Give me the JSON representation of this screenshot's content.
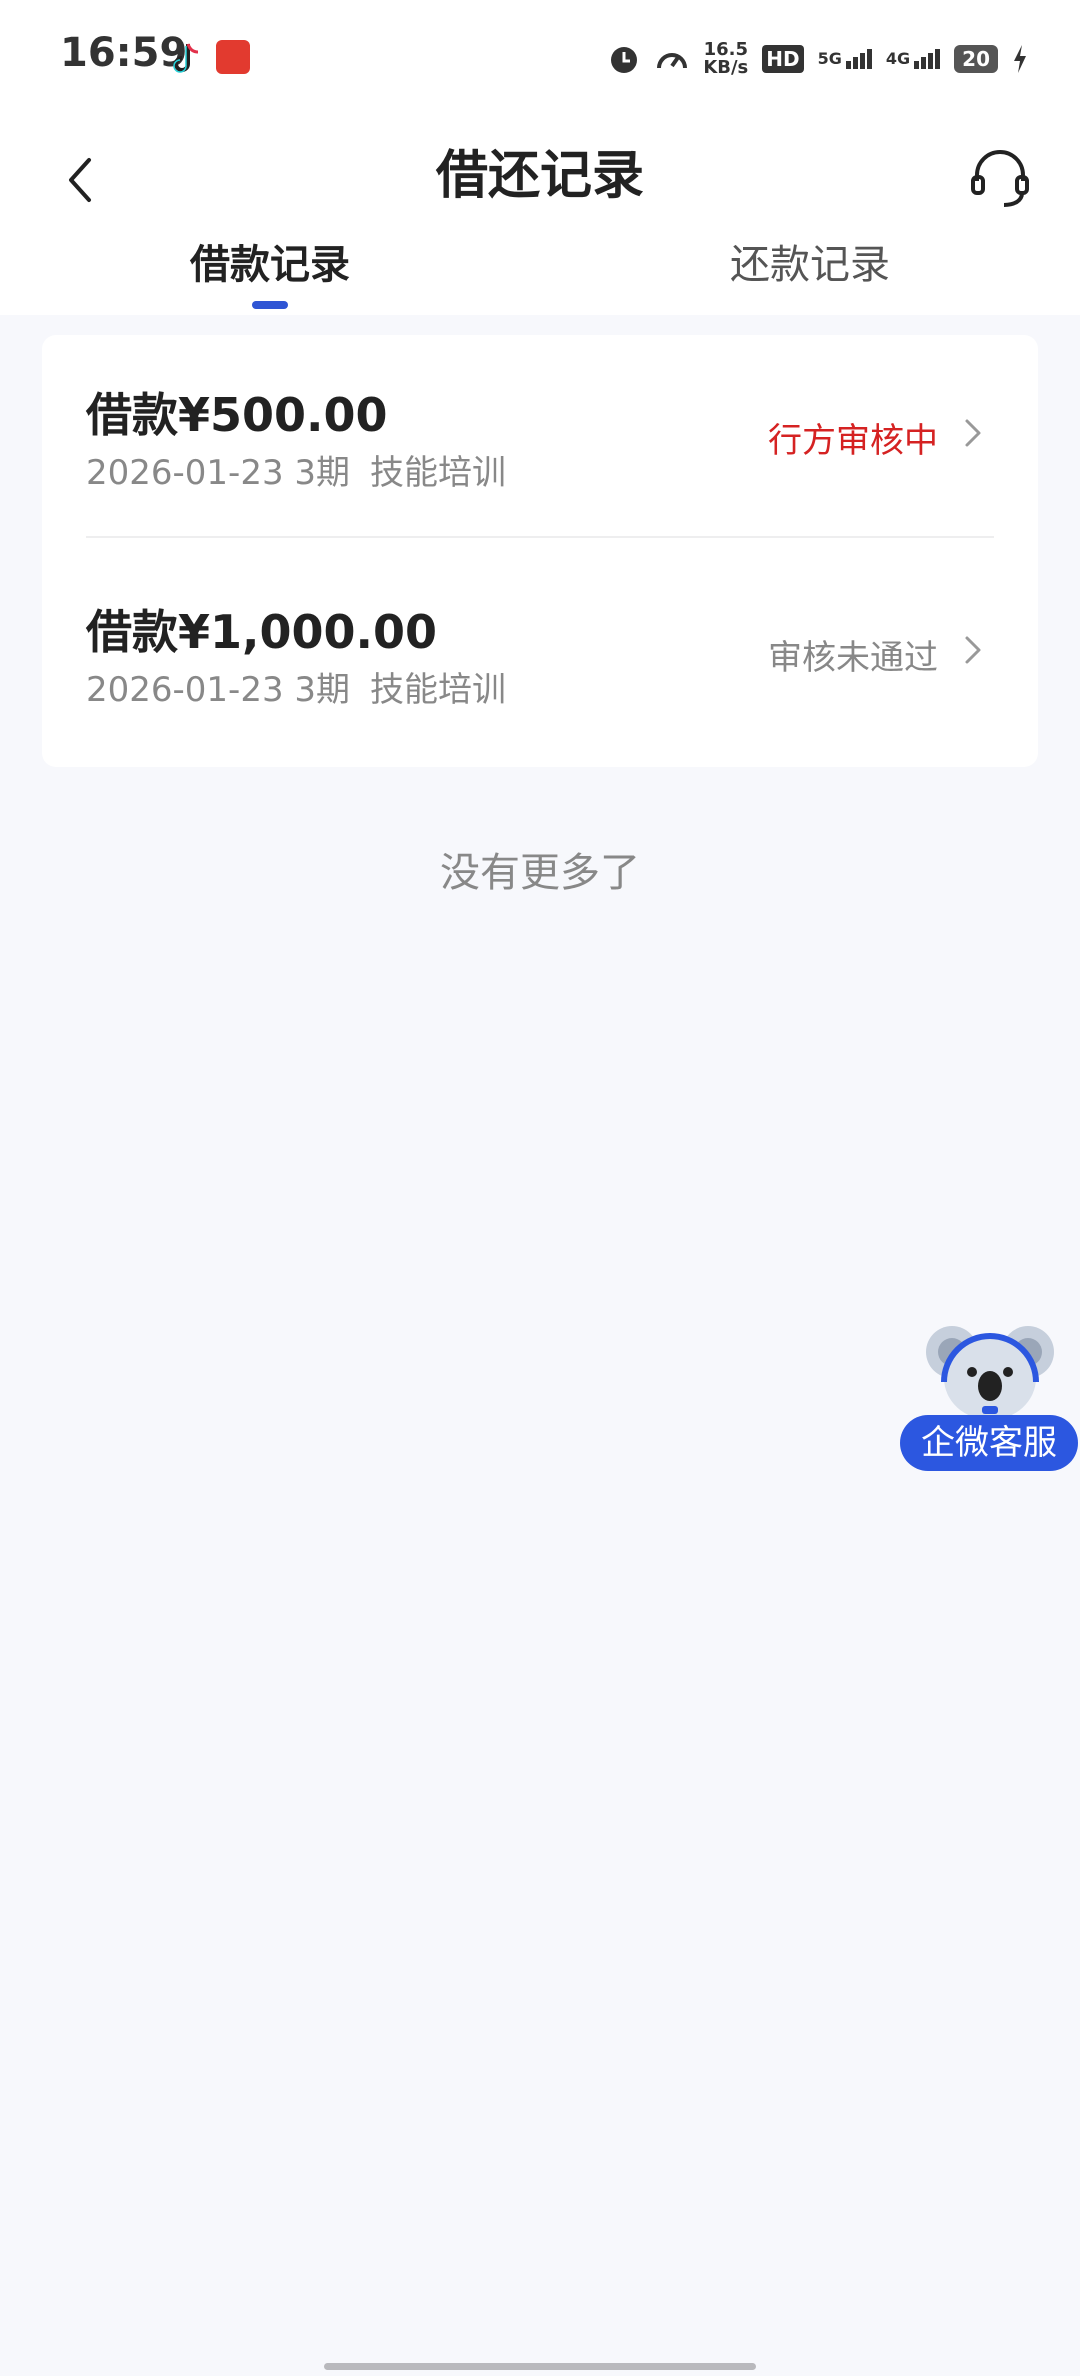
{
  "status_bar": {
    "time": "16:59",
    "net_speed_value": "16.5",
    "net_speed_unit": "KB/s",
    "hd_label": "HD",
    "sim1_label": "5G",
    "sim2_label": "4G",
    "battery": "20"
  },
  "header": {
    "title": "借还记录",
    "back_icon": "chevron-left-icon",
    "service_icon": "headset-icon"
  },
  "tabs": [
    {
      "label": "借款记录",
      "active": true
    },
    {
      "label": "还款记录",
      "active": false
    }
  ],
  "records": [
    {
      "amount": "借款¥500.00",
      "date": "2026-01-23",
      "term": "3期",
      "purpose": "技能培训",
      "status": "行方审核中",
      "status_color": "#d52222"
    },
    {
      "amount": "借款¥1,000.00",
      "date": "2026-01-23",
      "term": "3期",
      "purpose": "技能培训",
      "status": "审核未通过",
      "status_color": "#888888"
    }
  ],
  "footer_text": "没有更多了",
  "float_service": {
    "label": "企微客服",
    "icon": "koala-mascot-icon"
  },
  "colors": {
    "accent": "#2f55d4",
    "float_button": "#2c57e0",
    "background": "#f7f8fc"
  }
}
